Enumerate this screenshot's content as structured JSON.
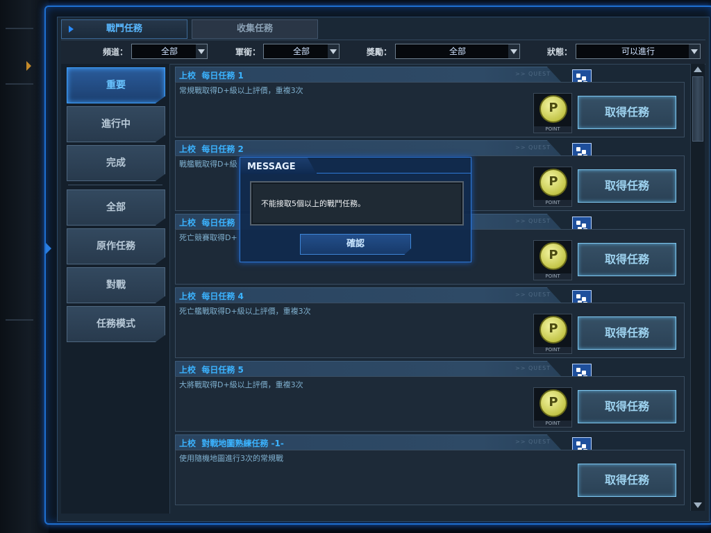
{
  "tabs": [
    {
      "label": "戰鬥任務",
      "active": true
    },
    {
      "label": "收集任務",
      "active": false
    }
  ],
  "filters": [
    {
      "label": "頻道：",
      "value": "全部"
    },
    {
      "label": "軍銜：",
      "value": "全部"
    },
    {
      "label": "獎勵：",
      "value": "全部"
    },
    {
      "label": "狀態：",
      "value": "可以進行"
    }
  ],
  "sidebar": {
    "group1": [
      {
        "label": "重要",
        "active": true
      },
      {
        "label": "進行中",
        "active": false
      },
      {
        "label": "完成",
        "active": false
      }
    ],
    "group2": [
      {
        "label": "全部"
      },
      {
        "label": "原作任務"
      },
      {
        "label": "對戰"
      },
      {
        "label": "任務模式"
      }
    ]
  },
  "quest_tag": ">> QUEST",
  "coin": {
    "symbol": "P",
    "label": "POINT"
  },
  "quests": [
    {
      "rank": "上校",
      "title": "每日任務 1",
      "desc": "常規戰取得D+級以上評價，重複3次",
      "reward": "point",
      "button": "取得任務"
    },
    {
      "rank": "上校",
      "title": "每日任務 2",
      "desc": "戰艦戰取得D+級",
      "reward": "point",
      "button": "取得任務"
    },
    {
      "rank": "上校",
      "title": "每日任務",
      "desc": "死亡競賽取得D+",
      "reward": "point",
      "button": "取得任務"
    },
    {
      "rank": "上校",
      "title": "每日任務 4",
      "desc": "死亡艦戰取得D+級以上評價，重複3次",
      "reward": "point",
      "button": "取得任務"
    },
    {
      "rank": "上校",
      "title": "每日任務 5",
      "desc": "大將戰取得D+級以上評價，重複3次",
      "reward": "point",
      "button": "取得任務"
    },
    {
      "rank": "上校",
      "title": "對戰地圖熟練任務 -1-",
      "desc": "使用隨機地圖進行3次的常規戰",
      "reward": "none",
      "button": "取得任務"
    }
  ],
  "modal": {
    "title": "MESSAGE",
    "message": "不能接取5個以上的戰鬥任務。",
    "confirm": "確認"
  },
  "colors": {
    "accent": "#1e6fd0",
    "title_text": "#3bb3ff",
    "coin": "#c4c64a"
  }
}
